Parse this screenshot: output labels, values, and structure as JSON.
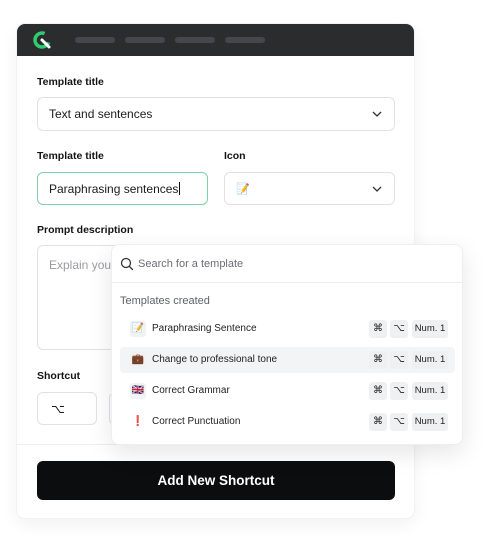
{
  "form": {
    "template_title_label": "Template title",
    "template_title_value": "Text and sentences",
    "second_title_label": "Template title",
    "second_title_value": "Paraphrasing sentences",
    "icon_label": "Icon",
    "icon_value": "📝",
    "prompt_label": "Prompt description",
    "prompt_text": "Explain your",
    "shortcut_label": "Shortcut",
    "shortcut_key": "⌥",
    "submit_label": "Add New Shortcut"
  },
  "dropdown": {
    "search_placeholder": "Search for a template",
    "section_title": "Templates created",
    "items": [
      {
        "emoji": "📝",
        "label": "Paraphrasing Sentence",
        "keys": [
          "⌘",
          "⌥",
          "Num. 1"
        ]
      },
      {
        "emoji": "💼",
        "label": "Change to professional tone",
        "keys": [
          "⌘",
          "⌥",
          "Num. 1"
        ]
      },
      {
        "emoji": "🇬🇧",
        "label": "Correct Grammar",
        "keys": [
          "⌘",
          "⌥",
          "Num. 1"
        ]
      },
      {
        "emoji": "❗",
        "label": "Correct Punctuation",
        "keys": [
          "⌘",
          "⌥",
          "Num. 1"
        ]
      }
    ]
  },
  "colors": {
    "titlebar": "#2b2c2e",
    "accent_focus": "#7bd3a6",
    "logo_green": "#2ecc71",
    "cta_bg": "#0c0d0e"
  }
}
